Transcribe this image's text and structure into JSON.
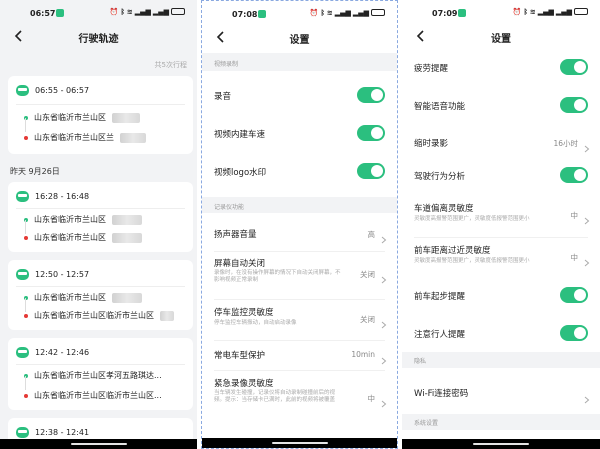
{
  "panel1": {
    "status_time": "06:57",
    "title": "行驶轨迹",
    "summary": "共5次行程",
    "day_label": "昨天 9月26日",
    "trips": [
      {
        "time": "06:55 - 06:57",
        "start": "山东省临沂市兰山区",
        "end": "山东省临沂市兰山区兰"
      },
      {
        "time": "16:28 - 16:48",
        "start": "山东省临沂市兰山区",
        "end": "山东省临沂市兰山区"
      },
      {
        "time": "12:50 - 12:57",
        "start": "山东省临沂市兰山区",
        "end": "山东省临沂市兰山区临沂市兰山区"
      },
      {
        "time": "12:42 - 12:46",
        "start": "山东省临沂市兰山区孝河五路琪达...",
        "end": "山东省临沂市兰山区临沂市兰山区..."
      },
      {
        "time": "12:38 - 12:41"
      }
    ]
  },
  "panel2": {
    "status_time": "07:08",
    "title": "设置",
    "section_video": "视频录制",
    "section_recorder": "记录仪功能",
    "items": [
      {
        "label": "录音"
      },
      {
        "label": "视频内建车速"
      },
      {
        "label": "视频logo水印"
      },
      {
        "label": "扬声器音量",
        "value": "高"
      },
      {
        "label": "屏幕自动关闭",
        "sub": "录像时，在没有操作屏幕的情况下自动关闭屏幕，不影响视频正常录制",
        "value": "关闭"
      },
      {
        "label": "停车监控灵敏度",
        "sub": "停车监控车辆振动，自动启动录像",
        "value": "关闭"
      },
      {
        "label": "常电车型保护",
        "value": "10min"
      },
      {
        "label": "紧急录像灵敏度",
        "sub": "当车辆发生碰撞，记录仪将自动录制碰撞前后的视频。提示：当存储卡已满时，此前的视频将被覆盖",
        "value": "中"
      }
    ]
  },
  "panel3": {
    "status_time": "07:09",
    "title": "设置",
    "section_privacy": "隐私",
    "section_system": "系统设置",
    "items": [
      {
        "label": "疲劳提醒"
      },
      {
        "label": "智能语音功能"
      },
      {
        "label": "缩时录影",
        "value": "16小时"
      },
      {
        "label": "驾驶行为分析"
      },
      {
        "label": "车道偏离灵敏度",
        "sub": "灵敏度高报警范围更广，灵敏度低报警范围更小",
        "value": "中"
      },
      {
        "label": "前车距离过近灵敏度",
        "sub": "灵敏度高报警范围更广，灵敏度低报警范围更小",
        "value": "中"
      },
      {
        "label": "前车起步提醒"
      },
      {
        "label": "注意行人提醒"
      },
      {
        "label": "Wi-Fi连接密码"
      }
    ]
  },
  "colors": {
    "accent": "#2bbf7f",
    "end_dot": "#e53935"
  },
  "icons": [
    "back-arrow-icon",
    "car-icon",
    "chevron-right-icon",
    "wifi-icon",
    "signal-icon",
    "battery-icon",
    "alarm-icon",
    "bluetooth-icon"
  ]
}
